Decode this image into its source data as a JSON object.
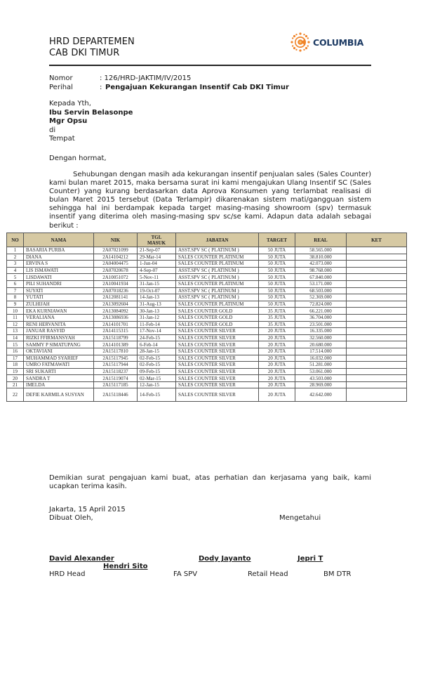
{
  "header": {
    "department": "HRD DEPARTEMEN",
    "branch": "CAB DKI TIMUR",
    "logo": {
      "icon": "sun-c-logo-icon",
      "text": "COLUMBIA",
      "text_color": "#1c3a63",
      "icon_color": "#f0842a"
    }
  },
  "meta": {
    "nomor_label": "Nomor",
    "nomor_value": ": 126/HRD-JAKTIM/IV/2015",
    "perihal_label": "Perihal",
    "perihal_colon": ":",
    "perihal_value": "Pengajuan Kekurangan Insentif Cab DKI Timur"
  },
  "recipient": {
    "greeting": "Kepada Yth,",
    "name": "Ibu Servin Belasonpe",
    "title": "Mgr Opsu",
    "di": "di",
    "place": "Tempat"
  },
  "body": {
    "salutation": "Dengan hormat,",
    "paragraph": "Sehubungan dengan masih ada kekurangan insentif penjualan sales (Sales Counter) kami bulan maret 2015, maka bersama surat ini kami mengajukan Ulang Insentif SC (Sales Counter) yang kurang berdasarkan data Aprova Konsumen yang terlambat realisasi di bulan Maret 2015 tersebut (Data Terlampir) dikarenakan sistem mati/gangguan sistem sehingga hal ini berdampak kepada target masing-masing showroom (spv) termasuk insentif yang diterima oleh masing-masing spv sc/se kami. Adapun data adalah sebagai berikut :",
    "closing": "Demikian surat pengajuan kami buat, atas perhatian dan kerjasama yang baik, kami ucapkan terima kasih."
  },
  "table": {
    "header_bg": "#d6c9a3",
    "columns": [
      "NO",
      "NAMA",
      "NIK",
      "TGL MASUK",
      "JABATAN",
      "TARGET",
      "REAL",
      "KET"
    ],
    "rows": [
      [
        "1",
        "BASARIA PURBA",
        "2A07021099",
        "21-Sep-07",
        "ASST.SPV SC ( PLATINUM )",
        "50 JUTA",
        "58.565.000",
        ""
      ],
      [
        "2",
        "DIANA",
        "2A14104212",
        "29-Mar-14",
        "SALES COUNTER PLATINUM",
        "50 JUTA",
        "38.810.000",
        ""
      ],
      [
        "3",
        "ERVINA S",
        "2A04004475",
        "1-Jun-04",
        "SALES COUNTER PLATINUM",
        "50 JUTA",
        "42.073.000",
        ""
      ],
      [
        "4",
        "LIS ISMAWATI",
        "2A07020678",
        "4-Sep-07",
        "ASST.SPV SC ( PLATINUM )",
        "50 JUTA",
        "98.768.000",
        ""
      ],
      [
        "5",
        "LISDAWATI",
        "2A10051072",
        "5-Nov-11",
        "ASST.SPV SC ( PLATINUM )",
        "50 JUTA",
        "67.840.000",
        ""
      ],
      [
        "6",
        "PILI SUHANDRI",
        "2A10041934",
        "31-Jan-15",
        "SALES COUNTER PLATINUM",
        "50 JUTA",
        "53.171.000",
        ""
      ],
      [
        "7",
        "SUYATI",
        "2A07018236",
        "19-Oct-07",
        "ASST.SPV SC ( PLATINUM )",
        "50 JUTA",
        "68.503.000",
        ""
      ],
      [
        "8",
        "YUTATI",
        "2A12081141",
        "14-Jan-13",
        "ASST.SPV SC ( PLATINUM )",
        "50 JUTA",
        "52.369.000",
        ""
      ],
      [
        "9",
        "ZULHIJAH",
        "2A13092604",
        "31-Aug-13",
        "SALES COUNTER PLATINUM",
        "50 JUTA",
        "72.824.000",
        ""
      ],
      [
        "10",
        "EKA KURNIAWAN",
        "2A13084092",
        "30-Jan-13",
        "SALES COUNTER GOLD",
        "35 JUTA",
        "66.221.000",
        ""
      ],
      [
        "11",
        "VERALIANA",
        "2A13086936",
        "31-Jan-12",
        "SALES COUNTER GOLD",
        "35 JUTA",
        "36.704.000",
        ""
      ],
      [
        "12",
        "RENI HERVANITA",
        "2A14101701",
        "11-Feb-14",
        "SALES COUNTER GOLD",
        "35 JUTA",
        "23.501.000",
        ""
      ],
      [
        "13",
        "JANUAR RASYID",
        "2A14115315",
        "17-Nov-14",
        "SALES COUNTER SILVER",
        "20 JUTA",
        "16.335.000",
        ""
      ],
      [
        "14",
        "RIZKI FFIRMANSYAH",
        "2A15118799",
        "24-Feb-15",
        "SALES COUNTER SILVER",
        "20 JUTA",
        "32.560.000",
        ""
      ],
      [
        "15",
        "SAMMY P SIMATUPANG",
        "2A14101389",
        "6-Feb-14",
        "SALES COUNTER SILVER",
        "20 JUTA",
        "20.680.000",
        ""
      ],
      [
        "16",
        "OKTAVIANI",
        "2A15117810",
        "28-Jan-15",
        "SALES COUNTER SILVER",
        "20 JUTA",
        "17.514.000",
        ""
      ],
      [
        "17",
        "MUHAMMAD SYARIEF",
        "2A15117945",
        "02-Feb-15",
        "SALES COUNTER SILVER",
        "20 JUTA",
        "16.032.000",
        ""
      ],
      [
        "18",
        "UMRO FATMAWATI",
        "2A15117944",
        "02-Feb-15",
        "SALES COUNTER SILVER",
        "20 JUTA",
        "51.281.000",
        ""
      ],
      [
        "19",
        "SRI SUKARTI",
        "2A15118237",
        "09-Feb-15",
        "SALES COUNTER SILVER",
        "20 JUTA",
        "53.061.000",
        ""
      ],
      [
        "20",
        "SANDRA T",
        "2A15119074",
        "02-Mar-15",
        "SALES COUNTER SILVER",
        "20 JUTA",
        "43.503.000",
        ""
      ],
      [
        "21",
        "IMELDA",
        "2A15117185",
        "12-Jan-15",
        "SALES COUNTER SILVER",
        "20 JUTA",
        "28.969.000",
        ""
      ],
      [
        "22",
        "DEFIE KARMILA SUSYAN",
        "2A15118446",
        "14-Feb-15",
        "SALES COUNTER SILVER",
        "20 JUTA",
        "42.642.000",
        ""
      ]
    ]
  },
  "footer": {
    "place_date": "Jakarta, 15 April 2015",
    "made_by": "Dibuat Oleh,",
    "acknowledged": "Mengetahui",
    "signatories": [
      {
        "name": "David Alexander",
        "title": "HRD Head"
      },
      {
        "name": "Hendri Sito",
        "title": "FA SPV"
      },
      {
        "name": "Dody Jayanto",
        "title": "Retail Head"
      },
      {
        "name": "Jepri T",
        "title": "BM DTR"
      }
    ]
  }
}
